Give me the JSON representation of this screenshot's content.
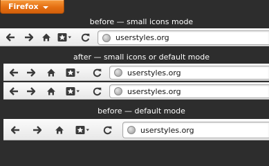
{
  "firefox_button": {
    "label": "Firefox"
  },
  "captions": {
    "before_small": "before — small icons mode",
    "after": "after — small icons or default mode",
    "before_default": "before — default mode"
  },
  "toolbars": [
    {
      "url": "userstyles.org"
    },
    {
      "url": "userstyles.org"
    },
    {
      "url": "userstyles.org"
    },
    {
      "url": "userstyles.org"
    }
  ],
  "colors": {
    "background": "#2d2d2d",
    "firefox_orange": "#e46f12",
    "icon": "#3a3a3a"
  }
}
